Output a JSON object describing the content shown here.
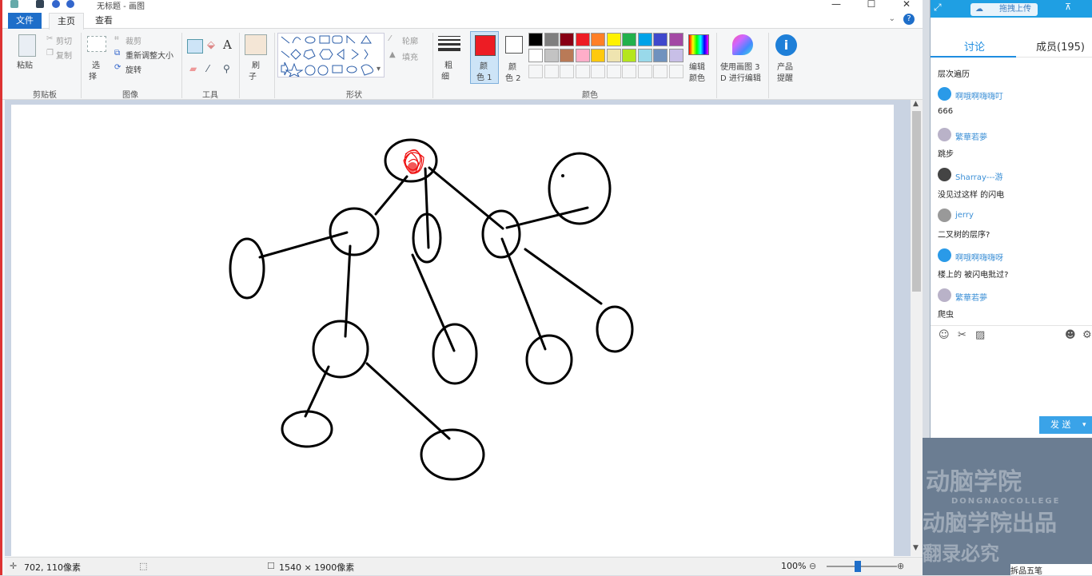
{
  "window": {
    "title": "无标题 - 画图",
    "minimize": "—",
    "maximize": "☐",
    "close": "✕"
  },
  "tabs": {
    "file": "文件",
    "home": "主页",
    "view": "查看",
    "help": "?"
  },
  "ribbon": {
    "clipboard": {
      "paste": "粘贴",
      "cut": "剪切",
      "copy": "复制",
      "label": "剪贴板"
    },
    "image": {
      "select": "选",
      "select2": "择",
      "crop": "裁剪",
      "resize": "重新调整大小",
      "rotate": "旋转",
      "label": "图像"
    },
    "tools": {
      "label": "工具"
    },
    "brush": {
      "l1": "刷",
      "l2": "子"
    },
    "shapes": {
      "outline": "轮廓",
      "fill": "填充",
      "label": "形状"
    },
    "size": {
      "l1": "粗",
      "l2": "细"
    },
    "color1": {
      "l1": "颜",
      "l2": "色 1"
    },
    "color2": {
      "l1": "颜",
      "l2": "色 2"
    },
    "colors": {
      "label": "颜色"
    },
    "edit_colors": {
      "l1": "编辑",
      "l2": "颜色"
    },
    "paint3d": {
      "l1": "使用画图 3",
      "l2": "D 进行编辑"
    },
    "product": {
      "l1": "产品",
      "l2": "提醒"
    }
  },
  "palette": {
    "row1": [
      "#000000",
      "#7f7f7f",
      "#880015",
      "#ed1c24",
      "#ff7f27",
      "#fff200",
      "#22b14c",
      "#00a2e8",
      "#3f48cc",
      "#a349a4"
    ],
    "row2": [
      "#ffffff",
      "#c3c3c3",
      "#b97a57",
      "#ffaec9",
      "#ffc90e",
      "#efe4b0",
      "#b5e61d",
      "#99d9ea",
      "#7092be",
      "#c8bfe7"
    ],
    "color1": "#ed1c24",
    "color2": "#ffffff"
  },
  "status": {
    "cursor": "702, 110像素",
    "size": "1540 × 1900像素",
    "zoom": "100%"
  },
  "chat": {
    "upload": "拖拽上传",
    "tab_discuss": "讨论",
    "tab_members": "成员(195)",
    "messages": [
      {
        "name": "",
        "text": "层次遍历"
      },
      {
        "name": "啊哦啊嗨嗨叮",
        "text": "666"
      },
      {
        "name": "繁華若夢",
        "text": "跳步"
      },
      {
        "name": "Sharray---游",
        "text": "没见过这样 的闪电"
      },
      {
        "name": "jerry",
        "text": "二叉树的层序?"
      },
      {
        "name": "啊哦啊嗨嗨呀",
        "text": "楼上的 被闪电批过?"
      },
      {
        "name": "繁華若夢",
        "text": "爬虫"
      }
    ],
    "send": "发 送"
  },
  "watermark": {
    "l1": "动脑学院",
    "l2": "DONGNAOCOLLEGE",
    "l3": "动脑学院出品",
    "l4": "翻录必究"
  },
  "taskbar": "拆品五笔"
}
